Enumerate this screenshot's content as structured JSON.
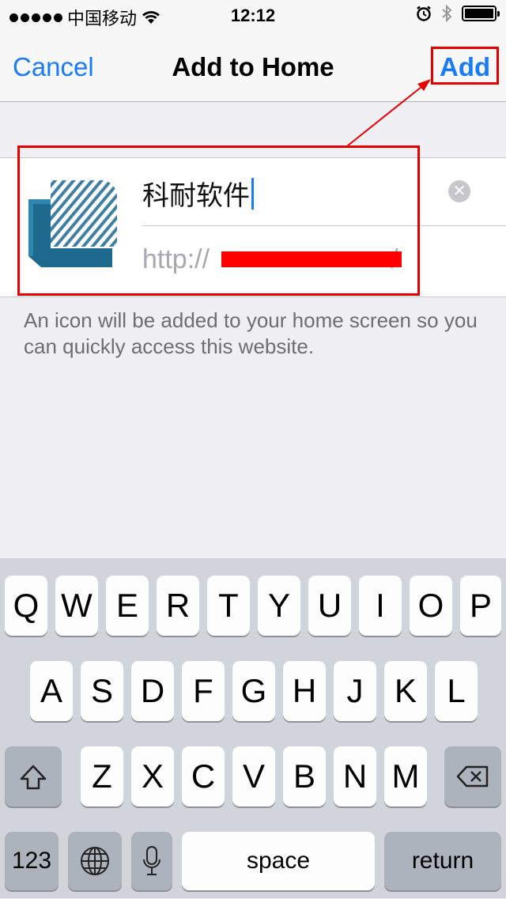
{
  "status_bar": {
    "carrier": "中国移动",
    "time": "12:12"
  },
  "nav": {
    "cancel": "Cancel",
    "title": "Add to Home",
    "add": "Add"
  },
  "bookmark": {
    "title_value": "科耐软件",
    "url_value": "http://",
    "url_suffix": "/"
  },
  "help_text": "An icon will be added to your home screen so you can quickly access this website.",
  "keyboard": {
    "row1": [
      "Q",
      "W",
      "E",
      "R",
      "T",
      "Y",
      "U",
      "I",
      "O",
      "P"
    ],
    "row2": [
      "A",
      "S",
      "D",
      "F",
      "G",
      "H",
      "J",
      "K",
      "L"
    ],
    "row3": [
      "Z",
      "X",
      "C",
      "V",
      "B",
      "N",
      "M"
    ],
    "numbers": "123",
    "space": "space",
    "return": "return"
  },
  "colors": {
    "accent": "#1a7cf5",
    "annotation": "#e60000"
  }
}
